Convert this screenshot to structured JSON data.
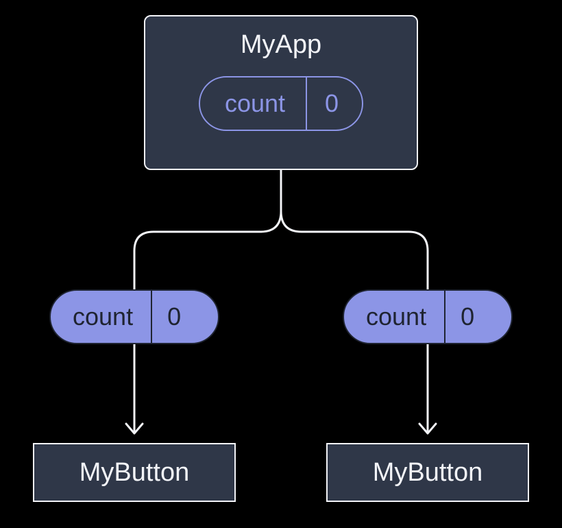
{
  "root": {
    "name": "MyApp",
    "state": {
      "label": "count",
      "value": "0"
    }
  },
  "props": {
    "left": {
      "label": "count",
      "value": "0"
    },
    "right": {
      "label": "count",
      "value": "0"
    }
  },
  "children": {
    "left": {
      "name": "MyButton"
    },
    "right": {
      "name": "MyButton"
    }
  },
  "colors": {
    "bg": "#000000",
    "panel": "#2f3748",
    "stroke": "#f3f4f8",
    "accent": "#8c95e6"
  }
}
